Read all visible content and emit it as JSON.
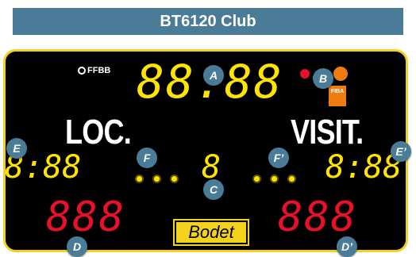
{
  "title": "BT6120 Club",
  "board": {
    "game_clock": "88:88",
    "period": "8",
    "home_label": "LOC.",
    "guest_label": "VISIT.",
    "home_timer": "8:88",
    "guest_timer": "8:88",
    "home_score": "888",
    "guest_score": "888",
    "ffbb_logo": "FFBB",
    "fiba_badge": "FIBA",
    "brand": "Bodet"
  },
  "callouts": {
    "a": "A",
    "b": "B",
    "c": "C",
    "d": "D",
    "d_prime": "D’",
    "e": "E",
    "e_prime": "E’",
    "f": "F",
    "f_prime": "F’"
  },
  "colors": {
    "title_bar": "#4a7b97",
    "board_border": "#f2d21b",
    "digit_yellow": "#ffe400",
    "digit_red": "#e8102a",
    "callout": "#4a7b97"
  },
  "fouls": {
    "home_count": 3,
    "guest_count": 3
  }
}
